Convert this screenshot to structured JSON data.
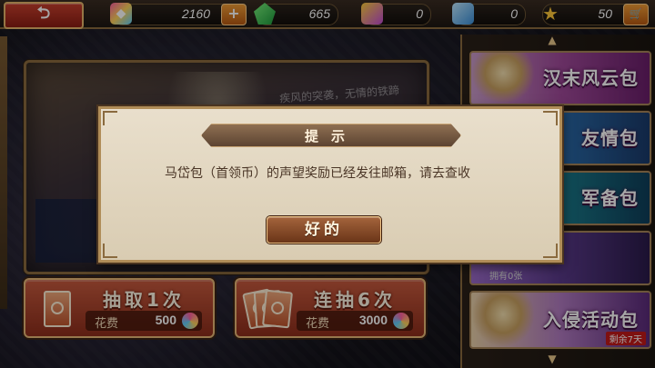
{
  "resources": {
    "diamond": "2160",
    "jade": "665",
    "ticket_a": "0",
    "ticket_b": "0",
    "star": "50"
  },
  "banner": {
    "caption": "疾风的突袭，无情的铁蹄"
  },
  "draw_buttons": [
    {
      "title": "抽取1次",
      "cost_label": "花费",
      "cost": "500"
    },
    {
      "title": "连抽6次",
      "cost_label": "花费",
      "cost": "3000"
    }
  ],
  "packs": [
    {
      "label": "汉末风云包"
    },
    {
      "label": "友情包"
    },
    {
      "label": "军备包"
    },
    {
      "label": "",
      "sub": "拥有0张"
    },
    {
      "label": "入侵活动包",
      "badge": "剩余7天"
    }
  ],
  "dialog": {
    "title": "提示",
    "message": "马岱包（首领币）的声望奖励已经发往邮箱，请去查收",
    "ok": "好的"
  },
  "colors": {
    "accent_red": "#c65a3e",
    "gold_border": "#e8b877",
    "dialog_bg": "#e9dfcc"
  }
}
